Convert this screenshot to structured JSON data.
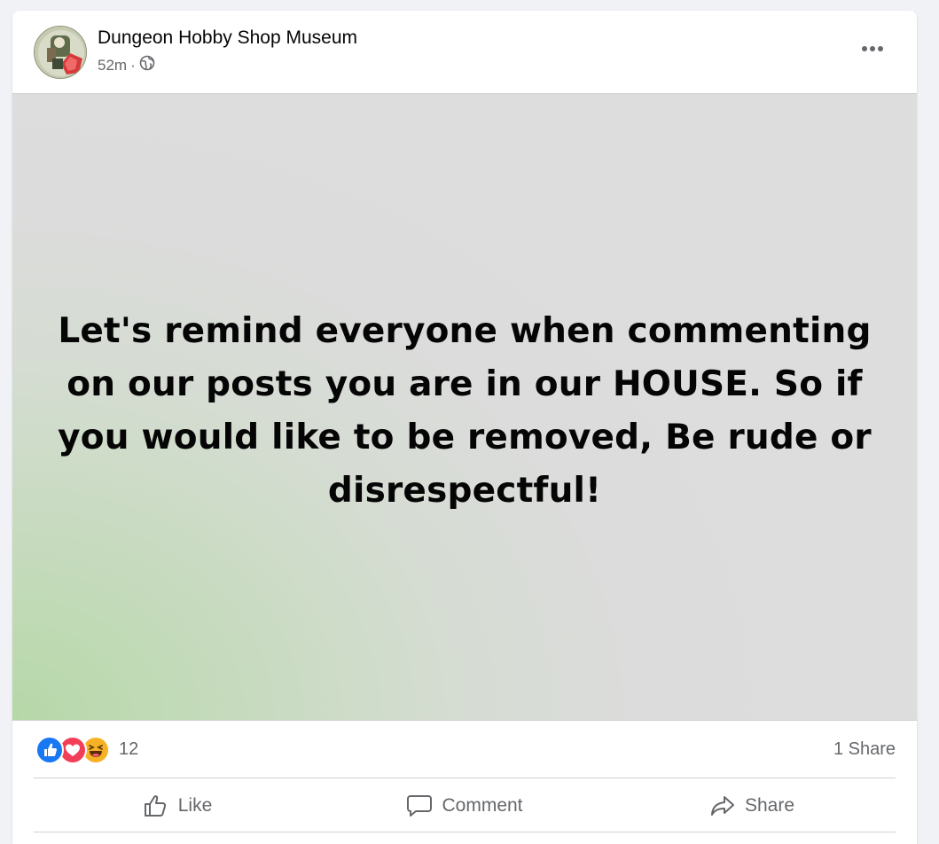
{
  "post": {
    "page_name": "Dungeon Hobby Shop Museum",
    "timestamp": "52m",
    "separator": "·",
    "audience_icon": "globe-icon",
    "menu_icon": "more-horizontal-icon",
    "body_text": "Let's remind everyone when commenting on our posts you are in our HOUSE. So if you would like to be removed, Be rude or disrespectful!",
    "background_colors": [
      "#b6d8a8",
      "#dddddd"
    ]
  },
  "engagement": {
    "reactions": [
      "like-reaction-icon",
      "love-reaction-icon",
      "haha-reaction-icon"
    ],
    "reaction_count": "12",
    "share_count": "1 Share"
  },
  "actions": {
    "like_label": "Like",
    "comment_label": "Comment",
    "share_label": "Share"
  },
  "colors": {
    "like_blue": "#1877f2",
    "love_red": "#f33e58",
    "haha_yellow": "#f7b125",
    "secondary_text": "#65676b"
  }
}
